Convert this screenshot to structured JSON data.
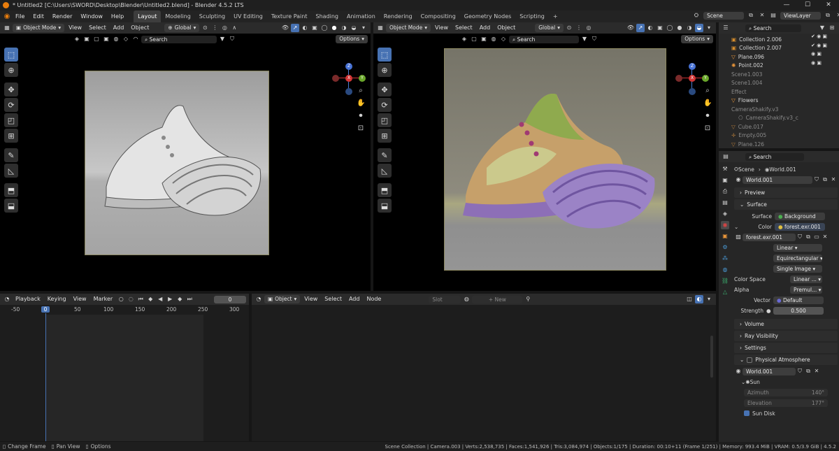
{
  "window": {
    "title": "* Untitled2 [C:\\Users\\SWORD\\Desktop\\Blender\\Untitled2.blend] - Blender 4.5.2 LTS",
    "controls": [
      "—",
      "☐",
      "✕"
    ]
  },
  "menubar": {
    "items": [
      "File",
      "Edit",
      "Render",
      "Window",
      "Help"
    ],
    "workspaces": [
      "Layout",
      "Modeling",
      "Sculpting",
      "UV Editing",
      "Texture Paint",
      "Shading",
      "Animation",
      "Rendering",
      "Compositing",
      "Geometry Nodes",
      "Scripting"
    ],
    "active_workspace": "Layout",
    "add_tab": "+",
    "scene": "Scene",
    "view_layer": "ViewLayer"
  },
  "viewport_left": {
    "mode": "Object Mode",
    "menus": [
      "View",
      "Select",
      "Add",
      "Object"
    ],
    "orientation": "Global",
    "search_placeholder": "Search",
    "options": "Options"
  },
  "viewport_right": {
    "mode": "Object Mode",
    "menus": [
      "View",
      "Select",
      "Add",
      "Object"
    ],
    "orientation": "Global",
    "search_placeholder": "Search",
    "options": "Options"
  },
  "gizmo": {
    "x": "X",
    "y": "Y",
    "z": "Z"
  },
  "outliner": {
    "search_placeholder": "Search",
    "rows": [
      {
        "name": "Collection 2.006",
        "dim": false
      },
      {
        "name": "Collection 2.007",
        "dim": false
      },
      {
        "name": "Plane.096",
        "dim": false
      },
      {
        "name": "Point.002",
        "dim": false
      },
      {
        "name": "Scene1.003",
        "dim": true
      },
      {
        "name": "Scene1.004",
        "dim": true
      },
      {
        "name": "Effect",
        "dim": true
      },
      {
        "name": "Flowers",
        "dim": false
      },
      {
        "name": "CameraShakify.v3",
        "dim": true
      },
      {
        "name": "CameraShakify.v3_c",
        "dim": true
      },
      {
        "name": "Cube.017",
        "dim": true
      },
      {
        "name": "Empty.005",
        "dim": true
      },
      {
        "name": "Plane.126",
        "dim": true
      }
    ]
  },
  "properties": {
    "search_placeholder": "Search",
    "breadcrumb_scene": "Scene",
    "breadcrumb_world": "World.001",
    "world_name": "World.001",
    "sections": {
      "preview": "Preview",
      "surface": "Surface",
      "volume": "Volume",
      "ray_visibility": "Ray Visibility",
      "settings": "Settings",
      "physical_atmosphere": "Physical Atmosphere",
      "sun": "Sun"
    },
    "surface_label": "Surface",
    "surface_value": "Background",
    "color_label": "Color",
    "color_value": "forest.exr.001",
    "image_name": "forest.exr.001",
    "interpolation": "Linear",
    "projection": "Equirectangular",
    "source": "Single Image",
    "color_space_label": "Color Space",
    "color_space_value": "Linear ...",
    "alpha_label": "Alpha",
    "alpha_value": "Premul...",
    "vector_label": "Vector",
    "vector_value": "Default",
    "strength_label": "Strength",
    "strength_value": "0.500",
    "atmo_world": "World.001",
    "azimuth_label": "Azimuth",
    "azimuth_value": "140°",
    "elevation_label": "Elevation",
    "elevation_value": "177°",
    "sun_disk": "Sun Disk"
  },
  "timeline": {
    "menus": [
      "Playback",
      "Keying",
      "View",
      "Marker"
    ],
    "current_frame": "0",
    "ticks": [
      "-50",
      "0",
      "50",
      "100",
      "150",
      "200",
      "250",
      "300"
    ]
  },
  "node_editor": {
    "object": "Object",
    "menus": [
      "View",
      "Select",
      "Add",
      "Node"
    ],
    "slot": "Slot",
    "new": "New"
  },
  "statusbar": {
    "left": [
      "Change Frame",
      "Pan View",
      "Options"
    ],
    "right": "Scene Collection | Camera.003 | Verts:2,538,735 | Faces:1,541,926 | Tris:3,084,974 | Objects:1/175 | Duration: 00:10+11 (Frame 1/251) | Memory: 993.4 MiB | VRAM: 0.5/3.9 GiB | 4.5.2"
  },
  "colors": {
    "accent": "#4772b3",
    "outline": "#e87d0d",
    "active_frame": "#4772b3"
  }
}
